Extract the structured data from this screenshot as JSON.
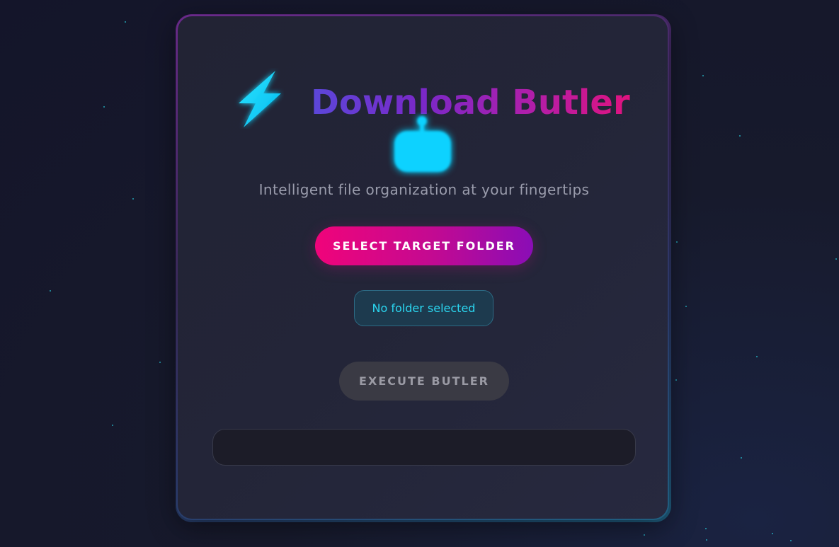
{
  "app": {
    "title": "Download Butler",
    "subtitle": "Intelligent file organization at your fingertips",
    "title_icon": "lightning-bolt-icon",
    "mascot_icon": "robot-icon"
  },
  "actions": {
    "select_folder_label": "SELECT TARGET FOLDER",
    "execute_label": "EXECUTE BUTLER",
    "execute_enabled": false
  },
  "status": {
    "folder_text": "No folder selected"
  },
  "log": {
    "text": ""
  },
  "colors": {
    "accent_cyan": "#00d4ff",
    "accent_pink": "#f0047a",
    "accent_purple": "#8a0db6",
    "background": "#171a2c"
  }
}
